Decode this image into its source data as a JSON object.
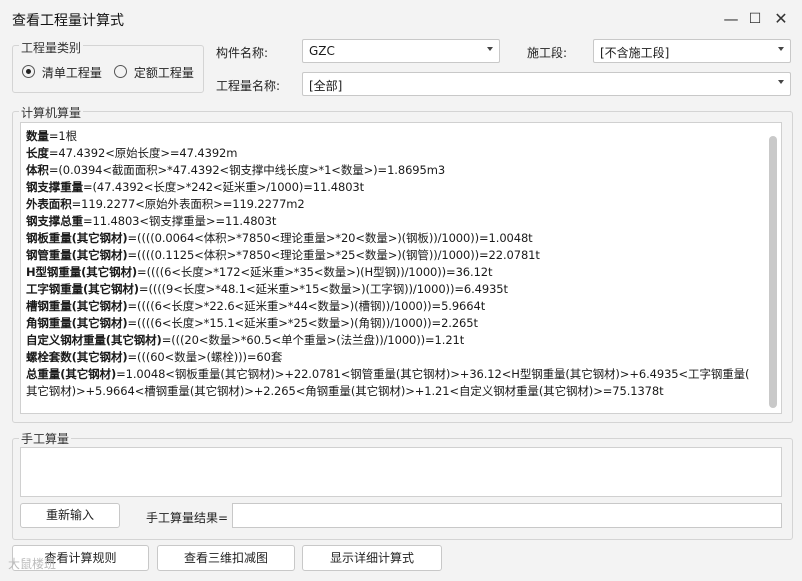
{
  "window": {
    "title": "查看工程量计算式"
  },
  "qty_type": {
    "legend": "工程量类别",
    "options": [
      {
        "label": "清单工程量",
        "selected": true
      },
      {
        "label": "定额工程量",
        "selected": false
      }
    ]
  },
  "filters": {
    "component_label": "构件名称:",
    "component_value": "GZC",
    "stage_label": "施工段:",
    "stage_value": "[不含施工段]",
    "qty_name_label": "工程量名称:",
    "qty_name_value": "[全部]"
  },
  "computer_calc": {
    "legend": "计算机算量",
    "lines": [
      {
        "name": "数量",
        "expr": "=1根"
      },
      {
        "name": "长度",
        "expr": "=47.4392<原始长度>=47.4392m"
      },
      {
        "name": "体积",
        "expr": "=(0.0394<截面面积>*47.4392<钢支撑中线长度>*1<数量>)=1.8695m3"
      },
      {
        "name": "钢支撑重量",
        "expr": "=(47.4392<长度>*242<延米重>/1000)=11.4803t"
      },
      {
        "name": "外表面积",
        "expr": "=119.2277<原始外表面积>=119.2277m2"
      },
      {
        "name": "钢支撑总重",
        "expr": "=11.4803<钢支撑重量>=11.4803t"
      },
      {
        "name": "钢板重量(其它钢材)",
        "expr": "=((((0.0064<体积>*7850<理论重量>*20<数量>)(钢板))/1000))=1.0048t"
      },
      {
        "name": "钢管重量(其它钢材)",
        "expr": "=((((0.1125<体积>*7850<理论重量>*25<数量>)(钢管))/1000))=22.0781t"
      },
      {
        "name": "H型钢重量(其它钢材)",
        "expr": "=((((6<长度>*172<延米重>*35<数量>)(H型钢))/1000))=36.12t"
      },
      {
        "name": "工字钢重量(其它钢材)",
        "expr": "=((((9<长度>*48.1<延米重>*15<数量>)(工字钢))/1000))=6.4935t"
      },
      {
        "name": "槽钢重量(其它钢材)",
        "expr": "=((((6<长度>*22.6<延米重>*44<数量>)(槽钢))/1000))=5.9664t"
      },
      {
        "name": "角钢重量(其它钢材)",
        "expr": "=((((6<长度>*15.1<延米重>*25<数量>)(角钢))/1000))=2.265t"
      },
      {
        "name": "自定义钢材重量(其它钢材)",
        "expr": "=(((20<数量>*60.5<单个重量>(法兰盘))/1000))=1.21t"
      },
      {
        "name": "螺栓套数(其它钢材)",
        "expr": "=(((60<数量>(螺栓)))=60套"
      },
      {
        "name": "总重量(其它钢材)",
        "expr": "=1.0048<钢板重量(其它钢材)>+22.0781<钢管重量(其它钢材)>+36.12<H型钢重量(其它钢材)>+6.4935<工字钢重量("
      },
      {
        "name": "",
        "expr": "其它钢材)>+5.9664<槽钢重量(其它钢材)>+2.265<角钢重量(其它钢材)>+1.21<自定义钢材重量(其它钢材)>=75.1378t"
      }
    ]
  },
  "manual_calc": {
    "legend": "手工算量",
    "reenter_button": "重新输入",
    "result_label": "手工算量结果="
  },
  "footer": {
    "view_rules_button": "查看计算规则",
    "view_3d_button": "查看三维扣减图",
    "show_detail_button": "显示详细计算式"
  },
  "watermark": "大鼠楼班"
}
